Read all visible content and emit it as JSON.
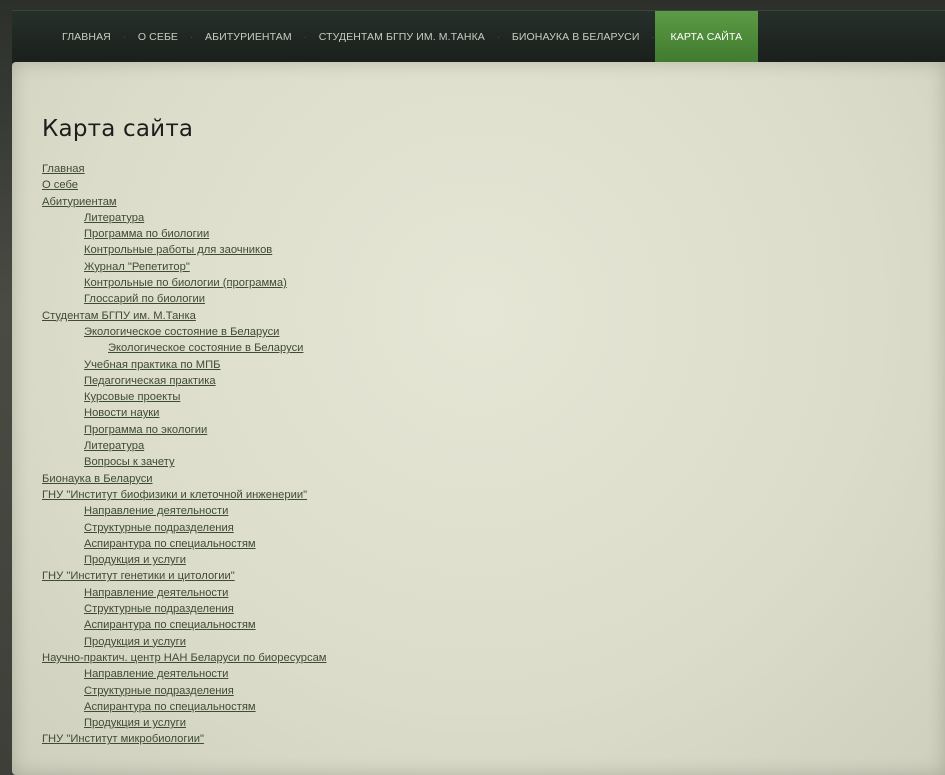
{
  "nav": {
    "items": [
      {
        "label": "ГЛАВНАЯ",
        "active": false
      },
      {
        "label": "О СЕБЕ",
        "active": false
      },
      {
        "label": "АБИТУРИЕНТАМ",
        "active": false
      },
      {
        "label": "СТУДЕНТАМ БГПУ ИМ. М.ТАНКА",
        "active": false
      },
      {
        "label": "БИОНАУКА В БЕЛАРУСИ",
        "active": false
      },
      {
        "label": "КАРТА САЙТА",
        "active": true
      }
    ],
    "active_color": "#4f8a3a"
  },
  "page": {
    "title": "Карта сайта"
  },
  "sitemap": [
    {
      "label": "Главная",
      "level": 0
    },
    {
      "label": "О себе",
      "level": 0
    },
    {
      "label": "Абитуриентам",
      "level": 0
    },
    {
      "label": "Литература",
      "level": 1
    },
    {
      "label": "Программа по биологии",
      "level": 1
    },
    {
      "label": "Контрольные работы для заочников",
      "level": 1
    },
    {
      "label": "Журнал \"Репетитор\"",
      "level": 1
    },
    {
      "label": "Контрольные по биологии (программа)",
      "level": 1
    },
    {
      "label": "Глоссарий по биологии",
      "level": 1
    },
    {
      "label": "Студентам БГПУ им. М.Танка",
      "level": 0
    },
    {
      "label": "Экологическое состояние в Беларуси",
      "level": 1
    },
    {
      "label": "Экологическое состояние в Беларуси ",
      "level": 2
    },
    {
      "label": "Учебная практика по МПБ",
      "level": 1
    },
    {
      "label": "Педагогическая практика",
      "level": 1
    },
    {
      "label": "Курсовые проекты",
      "level": 1
    },
    {
      "label": "Новости науки",
      "level": 1
    },
    {
      "label": "Программа по экологии",
      "level": 1
    },
    {
      "label": "Литература",
      "level": 1
    },
    {
      "label": "Вопросы к зачету",
      "level": 1
    },
    {
      "label": "Бионаука в Беларуси",
      "level": 0
    },
    {
      "label": "ГНУ \"Институт биофизики и клеточной инженерии\"",
      "level": 0
    },
    {
      "label": "Направление деятельности",
      "level": 1
    },
    {
      "label": "Структурные подразделения",
      "level": 1
    },
    {
      "label": "Аспирантура по специальностям",
      "level": 1
    },
    {
      "label": "Продукция и услуги",
      "level": 1
    },
    {
      "label": "ГНУ \"Институт генетики и цитологии\"",
      "level": 0
    },
    {
      "label": "Направление деятельности",
      "level": 1
    },
    {
      "label": "Структурные подразделения",
      "level": 1
    },
    {
      "label": "Аспирантура по специальностям",
      "level": 1
    },
    {
      "label": "Продукция и услуги",
      "level": 1
    },
    {
      "label": "Научно-практич. центр НАН Беларуси по биоресурсам",
      "level": 0
    },
    {
      "label": "Направление деятельности",
      "level": 1
    },
    {
      "label": "Структурные подразделения",
      "level": 1
    },
    {
      "label": "Аспирантура по специальностям",
      "level": 1
    },
    {
      "label": "Продукция и услуги",
      "level": 1
    },
    {
      "label": "ГНУ \"Институт микробиологии\"",
      "level": 0
    }
  ]
}
